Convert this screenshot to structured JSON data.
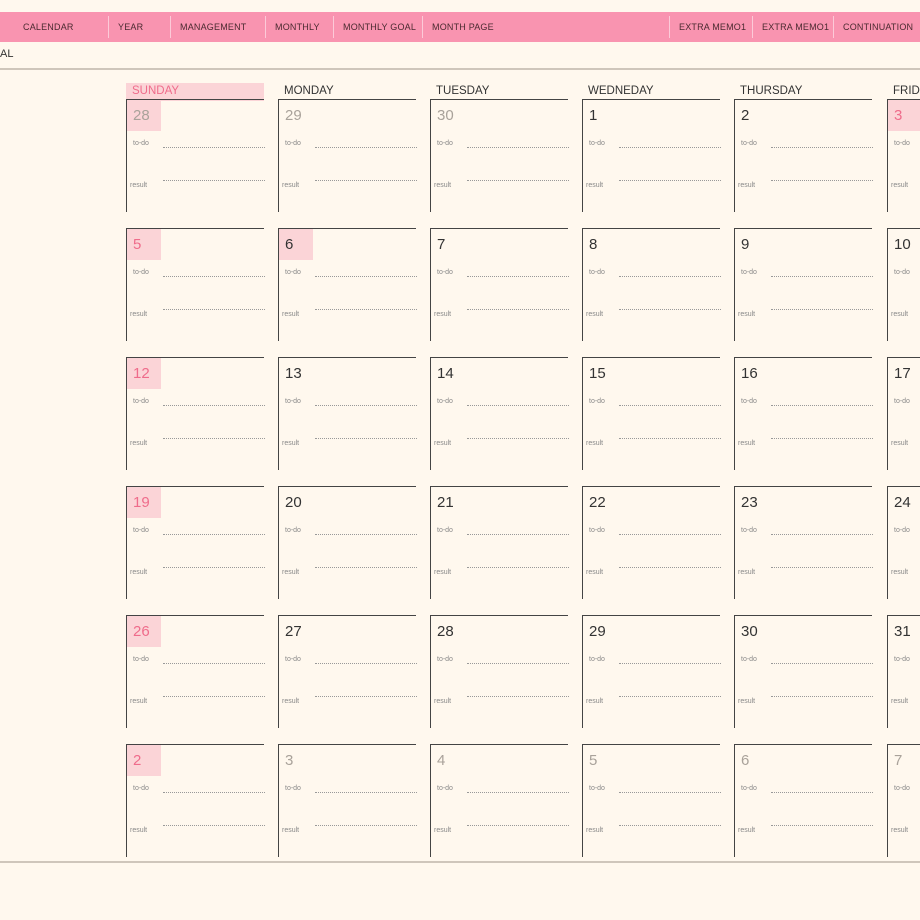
{
  "nav": {
    "items": [
      "CALENDAR",
      "YEAR",
      "MANAGEMENT",
      "MONTHLY",
      "MONTHLY GOAL",
      "MONTH PAGE",
      "EXTRA MEMO1",
      "EXTRA MEMO1",
      "CONTINUATION"
    ]
  },
  "goal_label": "AL",
  "weekdays": [
    "SUNDAY",
    "MONDAY",
    "TUESDAY",
    "WEDNEDAY",
    "THURSDAY",
    "FRIDAY"
  ],
  "cell_labels": {
    "todo": "to-do",
    "result": "result"
  },
  "weeks": [
    [
      {
        "n": "28",
        "s": "hl-muted"
      },
      {
        "n": "29",
        "s": "muted"
      },
      {
        "n": "30",
        "s": "muted"
      },
      {
        "n": "1",
        "s": ""
      },
      {
        "n": "2",
        "s": ""
      },
      {
        "n": "3",
        "s": "hl"
      }
    ],
    [
      {
        "n": "5",
        "s": "hl"
      },
      {
        "n": "6",
        "s": "hl-dark"
      },
      {
        "n": "7",
        "s": ""
      },
      {
        "n": "8",
        "s": ""
      },
      {
        "n": "9",
        "s": ""
      },
      {
        "n": "10",
        "s": ""
      }
    ],
    [
      {
        "n": "12",
        "s": "hl"
      },
      {
        "n": "13",
        "s": ""
      },
      {
        "n": "14",
        "s": ""
      },
      {
        "n": "15",
        "s": ""
      },
      {
        "n": "16",
        "s": ""
      },
      {
        "n": "17",
        "s": ""
      }
    ],
    [
      {
        "n": "19",
        "s": "hl"
      },
      {
        "n": "20",
        "s": ""
      },
      {
        "n": "21",
        "s": ""
      },
      {
        "n": "22",
        "s": ""
      },
      {
        "n": "23",
        "s": ""
      },
      {
        "n": "24",
        "s": ""
      }
    ],
    [
      {
        "n": "26",
        "s": "hl"
      },
      {
        "n": "27",
        "s": ""
      },
      {
        "n": "28",
        "s": ""
      },
      {
        "n": "29",
        "s": ""
      },
      {
        "n": "30",
        "s": ""
      },
      {
        "n": "31",
        "s": ""
      }
    ],
    [
      {
        "n": "2",
        "s": "hl"
      },
      {
        "n": "3",
        "s": "muted"
      },
      {
        "n": "4",
        "s": "muted"
      },
      {
        "n": "5",
        "s": "muted"
      },
      {
        "n": "6",
        "s": "muted"
      },
      {
        "n": "7",
        "s": "muted"
      }
    ]
  ],
  "colors": {
    "accent": "#f994b0",
    "highlight": "#fbd4d7",
    "sunday_text": "#ef6c8b",
    "background": "#fff8ee"
  }
}
